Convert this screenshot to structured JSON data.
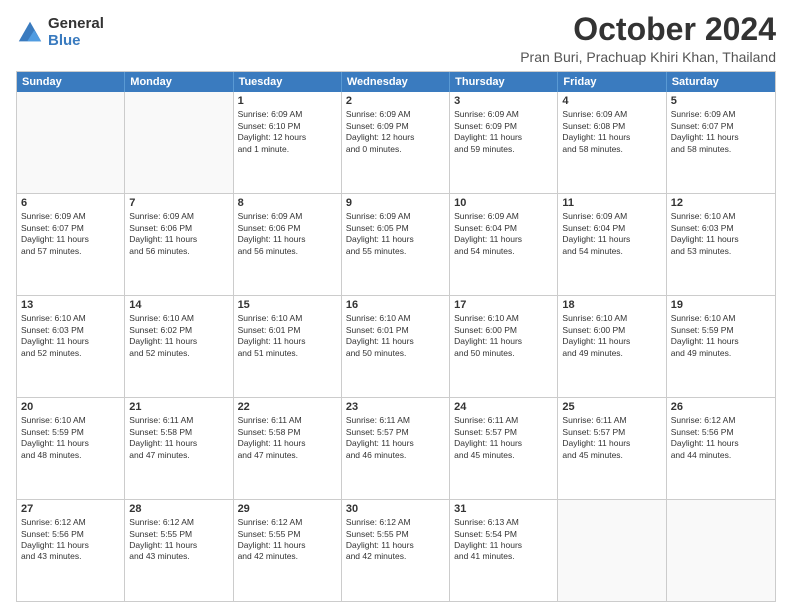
{
  "logo": {
    "general": "General",
    "blue": "Blue"
  },
  "title": "October 2024",
  "location": "Pran Buri, Prachuap Khiri Khan, Thailand",
  "days_header": [
    "Sunday",
    "Monday",
    "Tuesday",
    "Wednesday",
    "Thursday",
    "Friday",
    "Saturday"
  ],
  "weeks": [
    [
      {
        "day": "",
        "lines": []
      },
      {
        "day": "",
        "lines": []
      },
      {
        "day": "1",
        "lines": [
          "Sunrise: 6:09 AM",
          "Sunset: 6:10 PM",
          "Daylight: 12 hours",
          "and 1 minute."
        ]
      },
      {
        "day": "2",
        "lines": [
          "Sunrise: 6:09 AM",
          "Sunset: 6:09 PM",
          "Daylight: 12 hours",
          "and 0 minutes."
        ]
      },
      {
        "day": "3",
        "lines": [
          "Sunrise: 6:09 AM",
          "Sunset: 6:09 PM",
          "Daylight: 11 hours",
          "and 59 minutes."
        ]
      },
      {
        "day": "4",
        "lines": [
          "Sunrise: 6:09 AM",
          "Sunset: 6:08 PM",
          "Daylight: 11 hours",
          "and 58 minutes."
        ]
      },
      {
        "day": "5",
        "lines": [
          "Sunrise: 6:09 AM",
          "Sunset: 6:07 PM",
          "Daylight: 11 hours",
          "and 58 minutes."
        ]
      }
    ],
    [
      {
        "day": "6",
        "lines": [
          "Sunrise: 6:09 AM",
          "Sunset: 6:07 PM",
          "Daylight: 11 hours",
          "and 57 minutes."
        ]
      },
      {
        "day": "7",
        "lines": [
          "Sunrise: 6:09 AM",
          "Sunset: 6:06 PM",
          "Daylight: 11 hours",
          "and 56 minutes."
        ]
      },
      {
        "day": "8",
        "lines": [
          "Sunrise: 6:09 AM",
          "Sunset: 6:06 PM",
          "Daylight: 11 hours",
          "and 56 minutes."
        ]
      },
      {
        "day": "9",
        "lines": [
          "Sunrise: 6:09 AM",
          "Sunset: 6:05 PM",
          "Daylight: 11 hours",
          "and 55 minutes."
        ]
      },
      {
        "day": "10",
        "lines": [
          "Sunrise: 6:09 AM",
          "Sunset: 6:04 PM",
          "Daylight: 11 hours",
          "and 54 minutes."
        ]
      },
      {
        "day": "11",
        "lines": [
          "Sunrise: 6:09 AM",
          "Sunset: 6:04 PM",
          "Daylight: 11 hours",
          "and 54 minutes."
        ]
      },
      {
        "day": "12",
        "lines": [
          "Sunrise: 6:10 AM",
          "Sunset: 6:03 PM",
          "Daylight: 11 hours",
          "and 53 minutes."
        ]
      }
    ],
    [
      {
        "day": "13",
        "lines": [
          "Sunrise: 6:10 AM",
          "Sunset: 6:03 PM",
          "Daylight: 11 hours",
          "and 52 minutes."
        ]
      },
      {
        "day": "14",
        "lines": [
          "Sunrise: 6:10 AM",
          "Sunset: 6:02 PM",
          "Daylight: 11 hours",
          "and 52 minutes."
        ]
      },
      {
        "day": "15",
        "lines": [
          "Sunrise: 6:10 AM",
          "Sunset: 6:01 PM",
          "Daylight: 11 hours",
          "and 51 minutes."
        ]
      },
      {
        "day": "16",
        "lines": [
          "Sunrise: 6:10 AM",
          "Sunset: 6:01 PM",
          "Daylight: 11 hours",
          "and 50 minutes."
        ]
      },
      {
        "day": "17",
        "lines": [
          "Sunrise: 6:10 AM",
          "Sunset: 6:00 PM",
          "Daylight: 11 hours",
          "and 50 minutes."
        ]
      },
      {
        "day": "18",
        "lines": [
          "Sunrise: 6:10 AM",
          "Sunset: 6:00 PM",
          "Daylight: 11 hours",
          "and 49 minutes."
        ]
      },
      {
        "day": "19",
        "lines": [
          "Sunrise: 6:10 AM",
          "Sunset: 5:59 PM",
          "Daylight: 11 hours",
          "and 49 minutes."
        ]
      }
    ],
    [
      {
        "day": "20",
        "lines": [
          "Sunrise: 6:10 AM",
          "Sunset: 5:59 PM",
          "Daylight: 11 hours",
          "and 48 minutes."
        ]
      },
      {
        "day": "21",
        "lines": [
          "Sunrise: 6:11 AM",
          "Sunset: 5:58 PM",
          "Daylight: 11 hours",
          "and 47 minutes."
        ]
      },
      {
        "day": "22",
        "lines": [
          "Sunrise: 6:11 AM",
          "Sunset: 5:58 PM",
          "Daylight: 11 hours",
          "and 47 minutes."
        ]
      },
      {
        "day": "23",
        "lines": [
          "Sunrise: 6:11 AM",
          "Sunset: 5:57 PM",
          "Daylight: 11 hours",
          "and 46 minutes."
        ]
      },
      {
        "day": "24",
        "lines": [
          "Sunrise: 6:11 AM",
          "Sunset: 5:57 PM",
          "Daylight: 11 hours",
          "and 45 minutes."
        ]
      },
      {
        "day": "25",
        "lines": [
          "Sunrise: 6:11 AM",
          "Sunset: 5:57 PM",
          "Daylight: 11 hours",
          "and 45 minutes."
        ]
      },
      {
        "day": "26",
        "lines": [
          "Sunrise: 6:12 AM",
          "Sunset: 5:56 PM",
          "Daylight: 11 hours",
          "and 44 minutes."
        ]
      }
    ],
    [
      {
        "day": "27",
        "lines": [
          "Sunrise: 6:12 AM",
          "Sunset: 5:56 PM",
          "Daylight: 11 hours",
          "and 43 minutes."
        ]
      },
      {
        "day": "28",
        "lines": [
          "Sunrise: 6:12 AM",
          "Sunset: 5:55 PM",
          "Daylight: 11 hours",
          "and 43 minutes."
        ]
      },
      {
        "day": "29",
        "lines": [
          "Sunrise: 6:12 AM",
          "Sunset: 5:55 PM",
          "Daylight: 11 hours",
          "and 42 minutes."
        ]
      },
      {
        "day": "30",
        "lines": [
          "Sunrise: 6:12 AM",
          "Sunset: 5:55 PM",
          "Daylight: 11 hours",
          "and 42 minutes."
        ]
      },
      {
        "day": "31",
        "lines": [
          "Sunrise: 6:13 AM",
          "Sunset: 5:54 PM",
          "Daylight: 11 hours",
          "and 41 minutes."
        ]
      },
      {
        "day": "",
        "lines": []
      },
      {
        "day": "",
        "lines": []
      }
    ]
  ]
}
